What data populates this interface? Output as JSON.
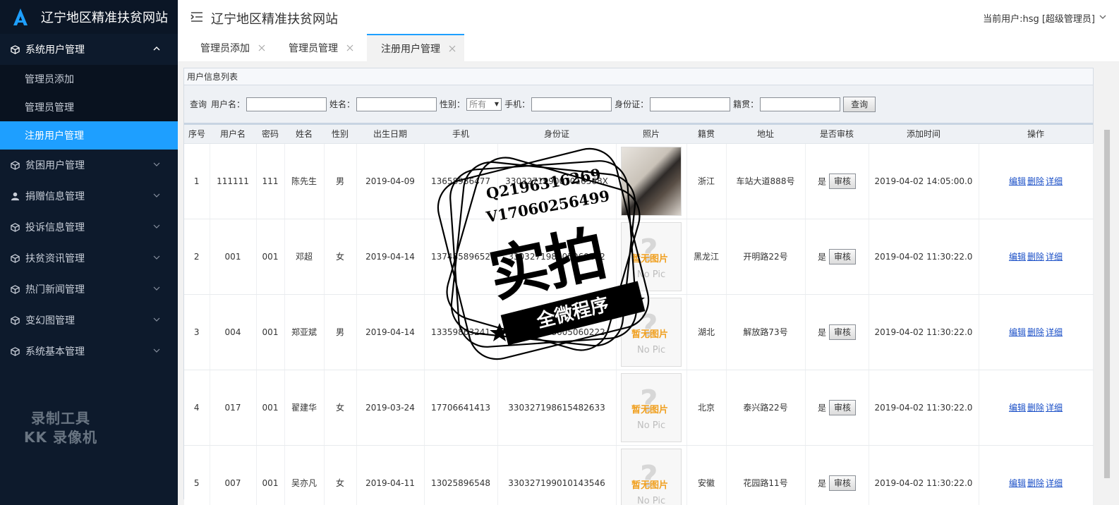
{
  "app": {
    "brand": "辽宁地区精准扶贫网站",
    "header_title": "辽宁地区精准扶贫网站",
    "current_user": "当前用户:hsg [超级管理员]"
  },
  "sidebar": {
    "items": [
      {
        "label": "系统用户管理",
        "icon": "cube-icon",
        "open": true
      },
      {
        "label": "贫困用户管理",
        "icon": "cube-icon"
      },
      {
        "label": "捐赠信息管理",
        "icon": "user-icon"
      },
      {
        "label": "投诉信息管理",
        "icon": "cube-icon"
      },
      {
        "label": "扶贫资讯管理",
        "icon": "cube-icon"
      },
      {
        "label": "热门新闻管理",
        "icon": "cube-icon"
      },
      {
        "label": "变幻图管理",
        "icon": "cube-icon"
      },
      {
        "label": "系统基本管理",
        "icon": "cube-icon"
      }
    ],
    "subitems": [
      {
        "label": "管理员添加"
      },
      {
        "label": "管理员管理"
      },
      {
        "label": "注册用户管理",
        "active": true
      }
    ],
    "recorder_watermark": [
      "录制工具",
      "KK 录像机"
    ]
  },
  "tabs": [
    {
      "label": "管理员添加"
    },
    {
      "label": "管理员管理"
    },
    {
      "label": "注册用户管理",
      "active": true
    }
  ],
  "panel": {
    "title": "用户信息列表"
  },
  "search": {
    "query_label": "查询",
    "username_label": "用户名：",
    "name_label": "姓名：",
    "gender_label": "性别：",
    "gender_value": "所有",
    "phone_label": "手机：",
    "id_label": "身份证：",
    "origin_label": "籍贯：",
    "button": "查询"
  },
  "table": {
    "columns": [
      "序号",
      "用户名",
      "密码",
      "姓名",
      "性别",
      "出生日期",
      "手机",
      "身份证",
      "照片",
      "籍贯",
      "地址",
      "是否审核",
      "添加时间",
      "操作"
    ],
    "audit_button": "审核",
    "actions": [
      "编辑",
      "删除",
      "详细"
    ],
    "nopic_cn": "暂无图片",
    "nopic_en": "No Pic",
    "rows": [
      {
        "no": "1",
        "username": "111111",
        "password": "111",
        "name": "陈先生",
        "gender": "男",
        "birth": "2019-04-09",
        "phone": "13658986477",
        "idcard": "330327199007016568X",
        "has_photo": true,
        "origin": "浙江",
        "address": "车站大道888号",
        "audited": "是",
        "added": "2019-04-02 14:05:00.0"
      },
      {
        "no": "2",
        "username": "001",
        "password": "001",
        "name": "邓超",
        "gender": "女",
        "birth": "2019-04-14",
        "phone": "13748589652",
        "idcard": "330327198605060222",
        "has_photo": false,
        "origin": "黑龙江",
        "address": "开明路22号",
        "audited": "是",
        "added": "2019-04-02 11:30:22.0"
      },
      {
        "no": "3",
        "username": "004",
        "password": "001",
        "name": "郑亚斌",
        "gender": "男",
        "birth": "2019-04-14",
        "phone": "13359863241",
        "idcard": "330327198605060222",
        "has_photo": false,
        "origin": "湖北",
        "address": "解放路73号",
        "audited": "是",
        "added": "2019-04-02 11:30:22.0"
      },
      {
        "no": "4",
        "username": "017",
        "password": "001",
        "name": "翟建华",
        "gender": "女",
        "birth": "2019-03-24",
        "phone": "17706641413",
        "idcard": "330327198615482633",
        "has_photo": false,
        "origin": "北京",
        "address": "泰兴路22号",
        "audited": "是",
        "added": "2019-04-02 11:30:22.0"
      },
      {
        "no": "5",
        "username": "007",
        "password": "001",
        "name": "吴亦凡",
        "gender": "女",
        "birth": "2019-04-11",
        "phone": "13025896548",
        "idcard": "330327199010143546",
        "has_photo": false,
        "origin": "安徽",
        "address": "花园路11号",
        "audited": "是",
        "added": "2019-04-02 11:30:22.0"
      }
    ]
  },
  "stamp": {
    "line1": "Q2196316269",
    "line2": "V17060256499",
    "big": "实拍",
    "ribbon": "全微程序"
  },
  "colors": {
    "sidebar_bg": "#0d1a2c",
    "accent": "#1e9fff",
    "link": "#1a4fc7"
  }
}
